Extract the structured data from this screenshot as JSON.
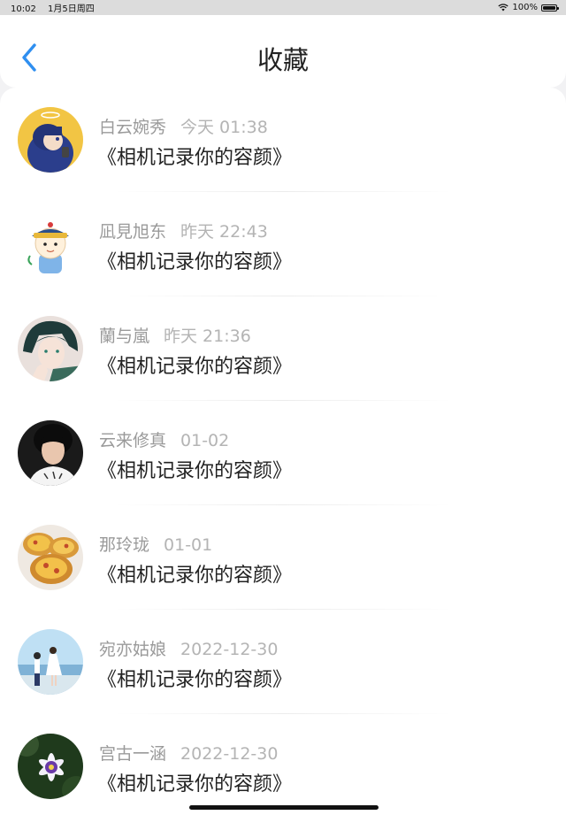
{
  "status_bar": {
    "time": "10:02",
    "date": "1月5日周四",
    "battery": "100%",
    "battery_level": 1.0
  },
  "nav": {
    "title": "收藏",
    "back_icon": "chevron-left-icon",
    "accent_color": "#2f8ff0"
  },
  "items": [
    {
      "name": "白云婉秀",
      "time": "今天 01:38",
      "message": "《相机记录你的容颜》",
      "avatar": "anime-character-avatar"
    },
    {
      "name": "凪見旭东",
      "time": "昨天 22:43",
      "message": "《相机记录你的容颜》",
      "avatar": "cartoon-qing-official-avatar"
    },
    {
      "name": "蘭与嵐",
      "time": "昨天 21:36",
      "message": "《相机记录你的容颜》",
      "avatar": "anime-boy-avatar"
    },
    {
      "name": "云来修真",
      "time": "01-02",
      "message": "《相机记录你的容颜》",
      "avatar": "portrait-photo-avatar"
    },
    {
      "name": "那玲珑",
      "time": "01-01",
      "message": "《相机记录你的容颜》",
      "avatar": "egg-tart-photo-avatar"
    },
    {
      "name": "宛亦姑娘",
      "time": "2022-12-30",
      "message": "《相机记录你的容颜》",
      "avatar": "couple-seaside-avatar"
    },
    {
      "name": "宫古一涵",
      "time": "2022-12-30",
      "message": "《相机记录你的容颜》",
      "avatar": "flower-photo-avatar"
    }
  ]
}
